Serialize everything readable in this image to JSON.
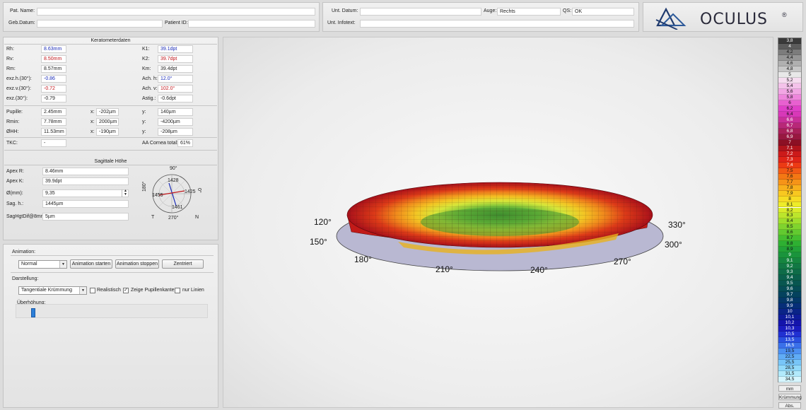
{
  "header": {
    "pat_name_label": "Pat. Name:",
    "pat_name_value": "",
    "geb_datum_label": "Geb.Datum:",
    "geb_datum_value": "",
    "patient_id_label": "Patient ID:",
    "patient_id_value": "",
    "unt_datum_label": "Unt. Datum:",
    "unt_datum_value": "",
    "auge_label": "Auge:",
    "auge_value": "Rechts",
    "qs_label": "QS:",
    "qs_value": "OK",
    "unt_infotext_label": "Unt. Infotext:",
    "unt_infotext_value": "",
    "logo_text": "OCULUS",
    "logo_reg": "®"
  },
  "kerato": {
    "title": "Keratometerdaten",
    "rh_label": "Rh:",
    "rh_value": "8.63mm",
    "rv_label": "Rv:",
    "rv_value": "8.50mm",
    "rm_label": "Rm:",
    "rm_value": "8.57mm",
    "exzh_label": "exz.h.(30°):",
    "exzh_value": "-0.86",
    "exzv_label": "exz.v.(30°):",
    "exzv_value": "-0.72",
    "exz_label": "exz.(30°):",
    "exz_value": "-0.79",
    "k1_label": "K1:",
    "k1_value": "39.1dpt",
    "k2_label": "K2:",
    "k2_value": "39.7dpt",
    "km_label": "Km:",
    "km_value": "39.4dpt",
    "achh_label": "Ach. h:",
    "achh_value": "12.0°",
    "achv_label": "Ach. v:",
    "achv_value": "102.0°",
    "astig_label": "Astig.:",
    "astig_value": "-0.6dpt",
    "pupille_label": "Pupille:",
    "pupille_value": "2.45mm",
    "pupille_x": "-202µm",
    "pupille_y": "140µm",
    "rmin_label": "Rmin:",
    "rmin_value": "7.78mm",
    "rmin_x": "2000µm",
    "rmin_y": "-4200µm",
    "ohh_label": "ØHH:",
    "ohh_value": "11.53mm",
    "ohh_x": "-190µm",
    "ohh_y": "-208µm",
    "x_label": "x:",
    "y_label": "y:",
    "tkc_label": "TKC:",
    "tkc_value": "-",
    "aa_label": "AA Cornea total:",
    "aa_value": "61%"
  },
  "sagittal": {
    "title": "Sagittale Höhe",
    "apexr_label": "Apex R:",
    "apexr_value": "8.46mm",
    "apexk_label": "Apex K:",
    "apexk_value": "39.9dpt",
    "diam_label": "Ø(mm):",
    "diam_value": "9,35",
    "sagh_label": "Sag. h.:",
    "sagh_value": "1445µm",
    "saghgt_label": "SagHgtDif@8mm:",
    "saghgt_value": "5µm",
    "compass": {
      "top": "90°",
      "bottom": "270°",
      "left": "180°",
      "right": "0°",
      "v_top": "1428",
      "v_left": "1455",
      "v_right": "1425",
      "v_bottom": "1461",
      "t": "T",
      "n": "N"
    }
  },
  "animation": {
    "label": "Animation:",
    "mode": "Normal",
    "start": "Animation starten",
    "stop": "Animation stoppen",
    "center": "Zentriert"
  },
  "darstellung": {
    "label": "Darstellung:",
    "mode": "Tangentiale Krümmung",
    "realistisch": "Realistisch",
    "zeige": "Zeige Pupillenkante",
    "nur_linien": "nur Linien",
    "ueberhoehung": "Überhöhung:"
  },
  "view3d": {
    "angles": [
      "120°",
      "150°",
      "180°",
      "210°",
      "240°",
      "270°",
      "300°",
      "330°"
    ]
  },
  "legend": {
    "values": [
      "3,8",
      "4",
      "4,2",
      "4,4",
      "4,6",
      "4,8",
      "5",
      "5,2",
      "5,4",
      "5,6",
      "5,8",
      "6",
      "6,2",
      "6,4",
      "6,6",
      "6,7",
      "6,8",
      "6,9",
      "7",
      "7,1",
      "7,2",
      "7,3",
      "7,4",
      "7,5",
      "7,6",
      "7,7",
      "7,8",
      "7,9",
      "8",
      "8,1",
      "8,2",
      "8,3",
      "8,4",
      "8,5",
      "8,6",
      "8,7",
      "8,8",
      "8,9",
      "9",
      "9,1",
      "9,2",
      "9,3",
      "9,4",
      "9,5",
      "9,6",
      "9,7",
      "9,8",
      "9,9",
      "10",
      "10,1",
      "10,2",
      "10,3",
      "10,5",
      "13,5",
      "16,5",
      "19,5",
      "22,5",
      "25,5",
      "28,5",
      "31,5",
      "34,5"
    ],
    "colors": [
      "#3a3a3a",
      "#5c5c5c",
      "#7c7c7c",
      "#969696",
      "#b0b0b0",
      "#c8c8c8",
      "#e8e8e8",
      "#f6dcf0",
      "#f4c2ea",
      "#f2a6e4",
      "#ee86dc",
      "#e860d0",
      "#e040c8",
      "#d838b8",
      "#c83098",
      "#b82878",
      "#a82058",
      "#981840",
      "#8c1024",
      "#b0141c",
      "#cc1a1a",
      "#e02418",
      "#ec3a14",
      "#f25a14",
      "#f47814",
      "#f69418",
      "#f8b01c",
      "#f8c820",
      "#f6dc24",
      "#eeec28",
      "#d8ec2a",
      "#bce62c",
      "#9ede2c",
      "#80d42e",
      "#62ca30",
      "#44be30",
      "#2eb032",
      "#22a238",
      "#1a943c",
      "#168640",
      "#127844",
      "#0e6c48",
      "#0a604c",
      "#085650",
      "#064c56",
      "#04425e",
      "#043868",
      "#062e78",
      "#0a2488",
      "#0e1c9a",
      "#1414ac",
      "#1a1cc0",
      "#2030d2",
      "#2a50e0",
      "#3a70ea",
      "#4c90f2",
      "#60acf6",
      "#78c6f8",
      "#92dafa",
      "#b2eafc",
      "#d6f6fe"
    ],
    "btn_mm": "mm",
    "btn_kruemmung": "Krümmung",
    "btn_abs": "Abs."
  }
}
